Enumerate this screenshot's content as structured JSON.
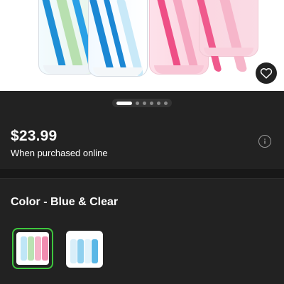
{
  "product": {
    "image_alt": "baby bottles",
    "favorite_icon": "heart-icon"
  },
  "carousel": {
    "total_dots": 6,
    "active_index": 0
  },
  "pricing": {
    "price": "$23.99",
    "note": "When purchased online",
    "info_icon": "info-icon"
  },
  "color": {
    "label": "Color - Blue & Clear",
    "options": [
      {
        "name": "Multicolor set",
        "selected": true
      },
      {
        "name": "Blue & Clear",
        "selected": false
      }
    ]
  },
  "colors": {
    "background": "#222222",
    "selected_outline": "#3ec73e",
    "text": "#ffffff"
  }
}
